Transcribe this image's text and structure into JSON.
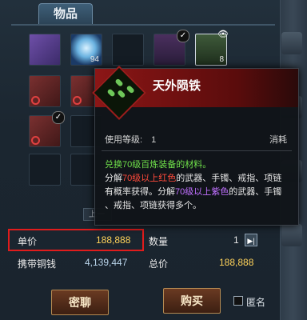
{
  "tab": {
    "label": "物品"
  },
  "grid": {
    "items": [
      {
        "id": "scroll",
        "qty": ""
      },
      {
        "id": "orb",
        "qty": "94"
      },
      {
        "id": "empty",
        "qty": ""
      },
      {
        "id": "helmet",
        "qty": ""
      },
      {
        "id": "ore",
        "qty": "8"
      }
    ]
  },
  "tooltip": {
    "title": "天外陨铁",
    "level_label": "使用等级:",
    "level_value": "1",
    "type_label": "消耗",
    "desc_line1": "兑换70级百炼装备的材料。",
    "desc_line2_a": "分解",
    "desc_line2_b": "70级以上红色",
    "desc_line2_c": "的武器、手镯、戒指、项链",
    "desc_line3_a": "有概率获得。分解",
    "desc_line3_b": "70级以上紫色",
    "desc_line3_c": "的武器、手镯",
    "desc_line4": "、戒指、项链获得多个。"
  },
  "pager": {
    "label": "上一"
  },
  "trade": {
    "unit_price_label": "单价",
    "unit_price_value": "188,888",
    "quantity_label": "数量",
    "quantity_value": "1",
    "copper_label": "携带铜钱",
    "copper_value": "4,139,447",
    "total_label": "总价",
    "total_value": "188,888"
  },
  "buttons": {
    "whisper": "密聊",
    "buy": "购买",
    "anonymous": "匿名"
  },
  "colors": {
    "highlight_box": "#e01c1c",
    "price": "#ffd35a",
    "green_text": "#6fe04a",
    "red_text": "#ff4a3a",
    "purple_text": "#c070ff"
  }
}
